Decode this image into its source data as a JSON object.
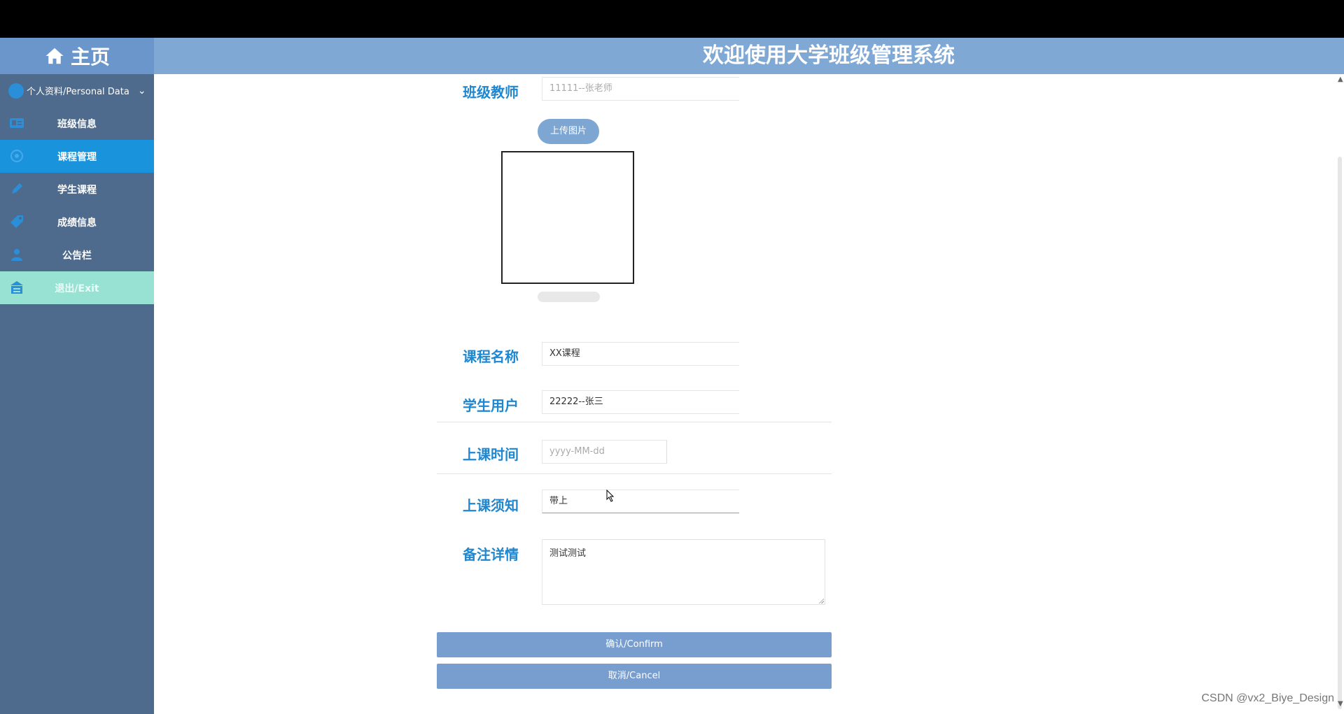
{
  "header": {
    "home_label": "主页",
    "title": "欢迎使用大学班级管理系统"
  },
  "sidebar": {
    "profile_label": "个人资料/Personal Data",
    "items": [
      {
        "label": "班级信息",
        "icon": "id-card-icon"
      },
      {
        "label": "课程管理",
        "icon": "course-icon",
        "active": true
      },
      {
        "label": "学生课程",
        "icon": "pen-icon"
      },
      {
        "label": "成绩信息",
        "icon": "tag-icon"
      },
      {
        "label": "公告栏",
        "icon": "people-icon"
      },
      {
        "label": "退出/Exit",
        "icon": "exit-icon"
      }
    ],
    "colors": {
      "background": "#4e6a8c",
      "active": "#1a93dd",
      "exit": "#98e2d4"
    }
  },
  "form": {
    "teacher": {
      "label": "班级教师",
      "value": "11111--张老师"
    },
    "upload_button": "上传图片",
    "course_name": {
      "label": "课程名称",
      "value": "XX课程"
    },
    "student_user": {
      "label": "学生用户",
      "value": "22222--张三"
    },
    "class_time": {
      "label": "上课时间",
      "placeholder": "yyyy-MM-dd"
    },
    "notice": {
      "label": "上课须知",
      "value": "带上"
    },
    "remarks": {
      "label": "备注详情",
      "value": "测试测试"
    },
    "confirm_button": "确认/Confirm",
    "cancel_button": "取消/Cancel"
  },
  "watermark": "CSDN @vx2_Biye_Design"
}
